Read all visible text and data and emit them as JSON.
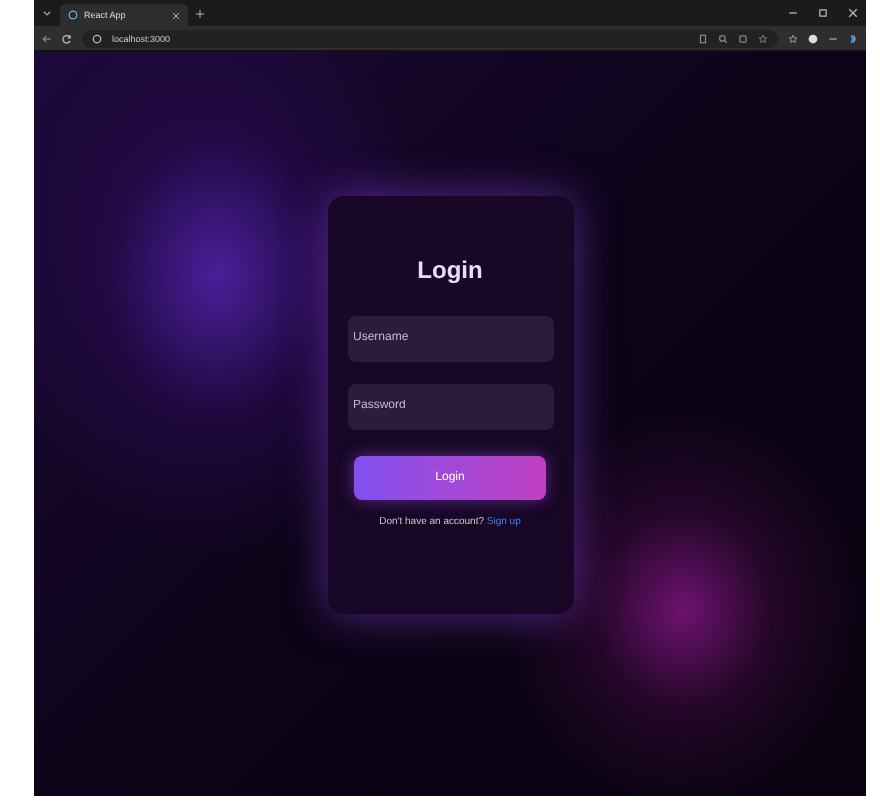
{
  "browser": {
    "tab_title": "React App",
    "url": "localhost:3000"
  },
  "login": {
    "title": "Login",
    "username": {
      "placeholder": "Username"
    },
    "password": {
      "placeholder": "Password"
    },
    "button": "Login",
    "prompt": "Don't have an account?",
    "link": "Sign up"
  }
}
